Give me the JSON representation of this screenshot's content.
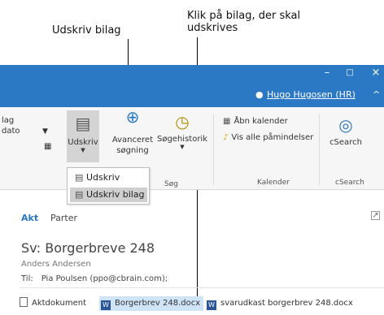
{
  "annotations": {
    "print_attachment": "Udskriv bilag",
    "click_attachment": "Klik på bilag, der skal udskrives"
  },
  "window": {
    "min_glyph": "–",
    "max_glyph": "□",
    "close_glyph": "×",
    "user_name": "Hugo Hugosen (HR)",
    "collapse_glyph": "^"
  },
  "ribbon": {
    "lag_label": "lag",
    "dato_label": "dato",
    "udskriv_label": "Udskriv",
    "avanceret_label": "Avanceret søgning",
    "sogehistorik_label": "Søgehistorik",
    "sog_group": "Søg",
    "abn_kalender": "Åbn kalender",
    "vis_paamindelser": "Vis alle påmindelser",
    "kalender_group": "Kalender",
    "csearch_label": "cSearch",
    "csearch_group": "cSearch"
  },
  "dropdown": {
    "items": [
      {
        "label": "Udskriv"
      },
      {
        "label": "Udskriv bilag"
      }
    ]
  },
  "nav": {
    "akt": "Akt",
    "parter": "Parter"
  },
  "message": {
    "subject": "Sv: Borgerbreve 248",
    "sender": "Anders Andersen",
    "to_label": "Til:",
    "to_value": "Pia Poulsen (ppo@cbrain.com);"
  },
  "attachments": [
    {
      "label": "Aktdokument"
    },
    {
      "label": "Borgerbrev 248.docx"
    },
    {
      "label": "svarudkast borgerbrev 248.docx"
    }
  ]
}
